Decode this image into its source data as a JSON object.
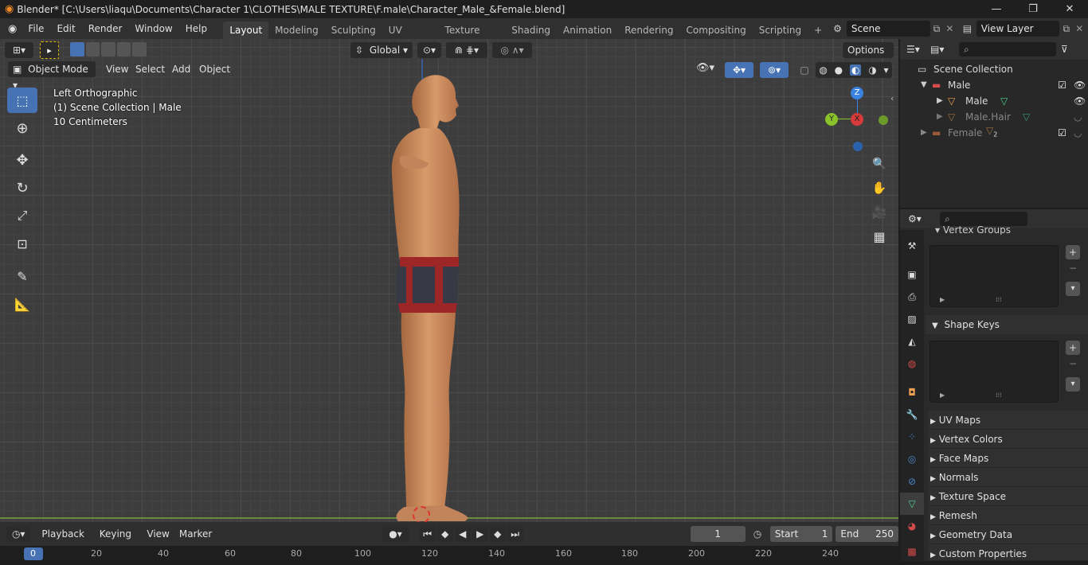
{
  "window": {
    "title": "Blender* [C:\\Users\\liaqu\\Documents\\Character 1\\CLOTHES\\MALE TEXTURE\\F.male\\Character_Male_&Female.blend]",
    "minimize": "—",
    "maximize": "❐",
    "close": "✕"
  },
  "menu": {
    "items": [
      "File",
      "Edit",
      "Render",
      "Window",
      "Help"
    ]
  },
  "workspaces": {
    "tabs": [
      "Layout",
      "Modeling",
      "Sculpting",
      "UV Editing",
      "Texture Paint",
      "Shading",
      "Animation",
      "Rendering",
      "Compositing",
      "Scripting"
    ],
    "active": "Layout",
    "add": "+"
  },
  "scene": {
    "name": "Scene",
    "view_layer": "View Layer"
  },
  "tool_header": {
    "transform_orientation": "Global",
    "options": "Options"
  },
  "viewport_header": {
    "mode": "Object Mode",
    "menus": [
      "View",
      "Select",
      "Add",
      "Object"
    ]
  },
  "overlay": {
    "view_name": "Left Orthographic",
    "collection": "(1) Scene Collection | Male",
    "scale": "10 Centimeters"
  },
  "gizmo": {
    "z": "Z",
    "y": "Y",
    "x": "X"
  },
  "outliner": {
    "root": "Scene Collection",
    "rows": [
      {
        "label": "Male",
        "level": 1,
        "type": "collection"
      },
      {
        "label": "Male",
        "level": 2,
        "type": "mesh"
      },
      {
        "label": "Male.Hair",
        "level": 2,
        "type": "mesh",
        "dim": true
      },
      {
        "label": "Female",
        "level": 1,
        "type": "collection",
        "dim": true,
        "badge": "2"
      }
    ]
  },
  "properties": {
    "vertex_groups": "Vertex Groups",
    "shape_keys": "Shape Keys",
    "collapsed": [
      "UV Maps",
      "Vertex Colors",
      "Face Maps",
      "Normals",
      "Texture Space",
      "Remesh",
      "Geometry Data",
      "Custom Properties"
    ]
  },
  "timeline": {
    "menus": [
      "Playback",
      "Keying",
      "View",
      "Marker"
    ],
    "current_frame": "1",
    "start_label": "Start",
    "start": "1",
    "end_label": "End",
    "end": "250",
    "ruler": [
      "0",
      "20",
      "40",
      "60",
      "80",
      "100",
      "120",
      "140",
      "160",
      "180",
      "200",
      "220",
      "240"
    ]
  },
  "colors": {
    "accent": "#4772b3",
    "skin": "#c98a5e",
    "shorts": "#373a45",
    "trim": "#9d2626",
    "x_axis": "#d63a3a",
    "y_axis": "#8ac22b",
    "z_axis": "#3a82e0"
  }
}
